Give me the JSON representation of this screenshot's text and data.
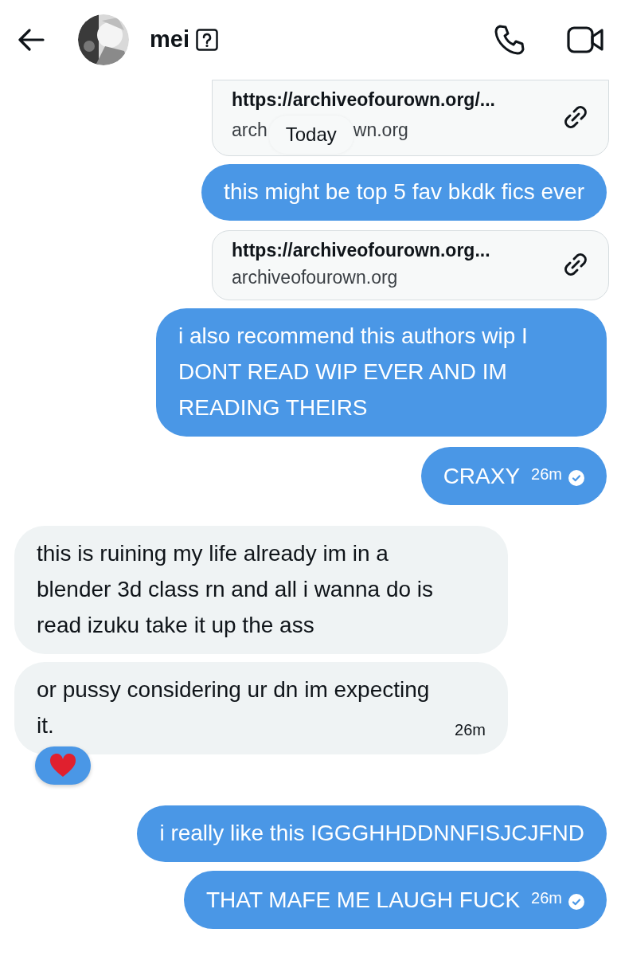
{
  "header": {
    "name": "mei"
  },
  "messages": [
    {
      "kind": "link",
      "url": "https://archiveofourown.org/...",
      "domain_parts": [
        "arch",
        "wn.org"
      ],
      "overlay_label": "Today"
    },
    {
      "kind": "text",
      "sent": true,
      "text": "this might be top 5 fav bkdk fics ever"
    },
    {
      "kind": "link",
      "url": "https://archiveofourown.org...",
      "domain_parts": [
        "archiveofourown.org"
      ]
    },
    {
      "kind": "text",
      "sent": true,
      "text": "i also recommend this authors wip I DONT READ WIP EVER AND IM READING THEIRS"
    },
    {
      "kind": "text",
      "sent": true,
      "text": "CRAXY",
      "time": "26m",
      "read": true
    },
    {
      "kind": "text",
      "sent": false,
      "text": "this is ruining my life already im in a blender 3d class rn and all i wanna do is read izuku take it up the ass"
    },
    {
      "kind": "text",
      "sent": false,
      "text": "or pussy considering ur dn im expecting it.",
      "time": "26m",
      "hearted": true
    },
    {
      "kind": "text",
      "sent": true,
      "text": "i really like this IGGGHHDDNNFISJCJFND"
    },
    {
      "kind": "text",
      "sent": true,
      "text": "THAT MAFE ME LAUGH FUCK",
      "time": "26m",
      "read": true
    }
  ]
}
